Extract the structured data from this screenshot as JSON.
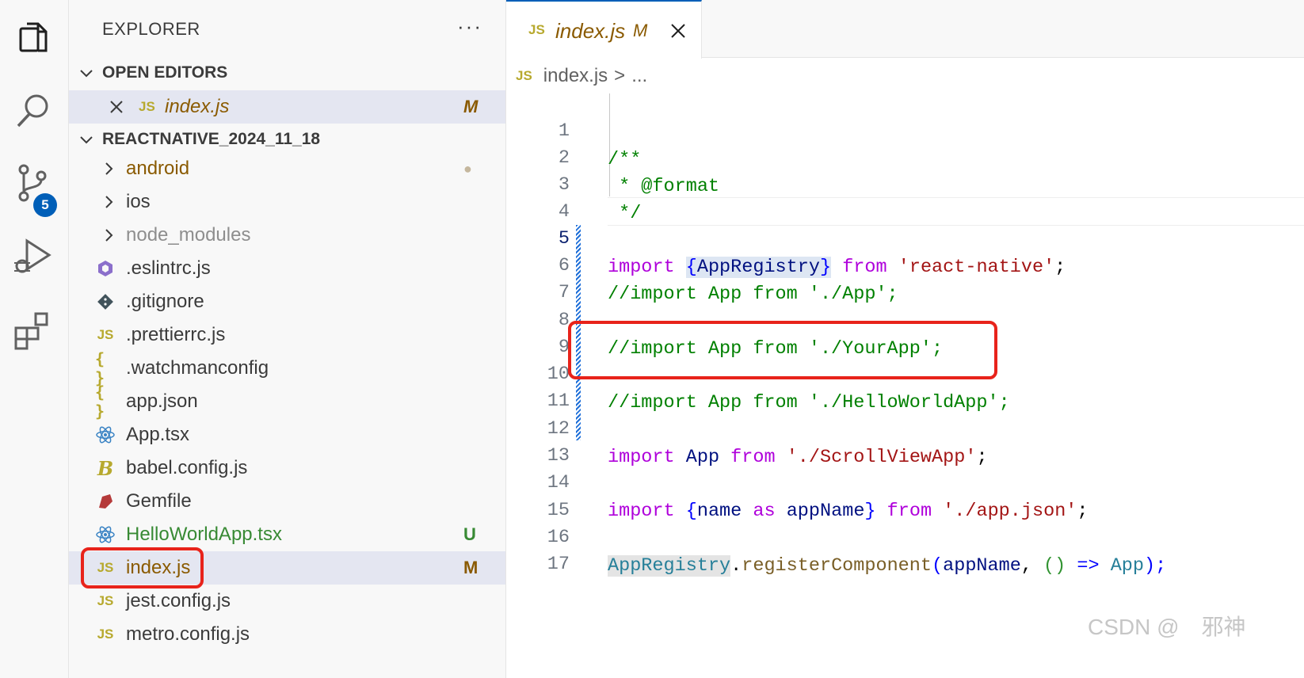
{
  "activity_bar": {
    "items": [
      "explorer-icon",
      "search-icon",
      "source-control-icon",
      "run-debug-icon",
      "extensions-icon"
    ],
    "source_control_badge": "5"
  },
  "sidebar": {
    "title": "EXPLORER",
    "more": "···",
    "open_editors": {
      "header": "OPEN EDITORS",
      "items": [
        {
          "icon": "JS",
          "name": "index.js",
          "status": "M"
        }
      ]
    },
    "project": {
      "header": "REACTNATIVE_2024_11_18",
      "items": [
        {
          "name": "android",
          "type": "folder",
          "status": "●",
          "color": "#8a5a00"
        },
        {
          "name": "ios",
          "type": "folder",
          "status": "",
          "color": "#3b3b3b"
        },
        {
          "name": "node_modules",
          "type": "folder",
          "status": "",
          "color": "#8e8e8e"
        },
        {
          "name": ".eslintrc.js",
          "icon": "eslint-icon",
          "status": "",
          "color": "#3b3b3b"
        },
        {
          "name": ".gitignore",
          "icon": "git-icon",
          "status": "",
          "color": "#3b3b3b"
        },
        {
          "name": ".prettierrc.js",
          "icon": "JS",
          "status": "",
          "color": "#3b3b3b"
        },
        {
          "name": ".watchmanconfig",
          "icon": "{ }",
          "status": "",
          "color": "#3b3b3b"
        },
        {
          "name": "app.json",
          "icon": "{ }",
          "status": "",
          "color": "#3b3b3b"
        },
        {
          "name": "App.tsx",
          "icon": "react-icon",
          "status": "",
          "color": "#3b3b3b"
        },
        {
          "name": "babel.config.js",
          "icon": "babel-icon",
          "status": "",
          "color": "#3b3b3b"
        },
        {
          "name": "Gemfile",
          "icon": "ruby-icon",
          "status": "",
          "color": "#3b3b3b"
        },
        {
          "name": "HelloWorldApp.tsx",
          "icon": "react-icon",
          "status": "U",
          "color": "#388a34"
        },
        {
          "name": "index.js",
          "icon": "JS",
          "status": "M",
          "color": "#8a5a00"
        },
        {
          "name": "jest.config.js",
          "icon": "JS",
          "status": "",
          "color": "#3b3b3b"
        },
        {
          "name": "metro.config.js",
          "icon": "JS",
          "status": "",
          "color": "#3b3b3b"
        }
      ]
    }
  },
  "editor": {
    "tab": {
      "icon": "JS",
      "label": "index.js",
      "modified": "M"
    },
    "breadcrumb": {
      "icon": "JS",
      "file": "index.js",
      "separator": ">",
      "rest": "..."
    },
    "lines": [
      "1",
      "2",
      "3",
      "4",
      "5",
      "6",
      "7",
      "8",
      "9",
      "10",
      "11",
      "12",
      "13",
      "14",
      "15",
      "16",
      "17"
    ],
    "code": {
      "l1": "/**",
      "l2": " * @format",
      "l3": " */",
      "l5_kw": "import",
      "l5_ob": "{",
      "l5_id": "AppRegistry",
      "l5_cb": "}",
      "l5_from": "from",
      "l5_str": "'react-native'",
      "semi": ";",
      "l6": "//import App from './App';",
      "l8": "//import App from './YourApp';",
      "l10": "//import App from './HelloWorldApp';",
      "l12_kw": "import",
      "l12_id": "App",
      "l12_from": "from",
      "l12_str": "'./ScrollViewApp'",
      "l14_kw": "import",
      "l14_ob": "{",
      "l14_name": "name",
      "l14_as": "as",
      "l14_alias": "appName",
      "l14_cb": "}",
      "l14_from": "from",
      "l14_str": "'./app.json'",
      "l16_cls": "AppRegistry",
      "l16_dot": ".",
      "l16_fn": "registerComponent",
      "l16_op": "(",
      "l16_arg": "appName",
      "l16_comma": ", ",
      "l16_paren": "()",
      "l16_arrow": "=>",
      "l16_app": "App",
      "l16_end": ");"
    }
  },
  "watermark": "CSDN @　邪神"
}
